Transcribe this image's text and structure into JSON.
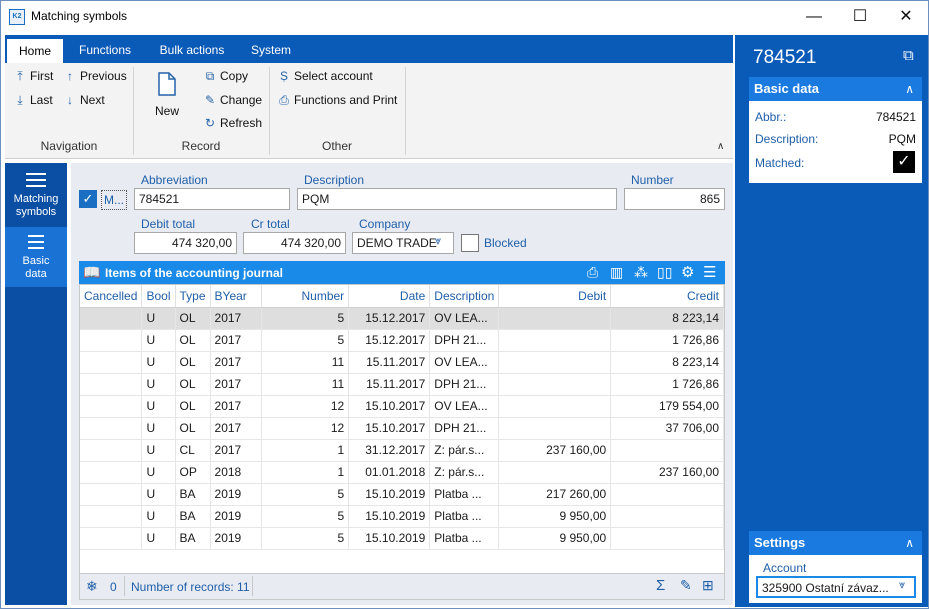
{
  "window": {
    "title": "Matching symbols",
    "app_icon": "k2-logo-icon",
    "minimize": "—",
    "maximize": "☐",
    "close": "✕"
  },
  "tabs": [
    "Home",
    "Functions",
    "Bulk actions",
    "System"
  ],
  "ribbon": {
    "navigation": {
      "label": "Navigation",
      "first": "First",
      "previous": "Previous",
      "last": "Last",
      "next": "Next"
    },
    "record": {
      "label": "Record",
      "new": "New",
      "copy": "Copy",
      "change": "Change",
      "refresh": "Refresh"
    },
    "other": {
      "label": "Other",
      "select_account": "Select account",
      "functions_print": "Functions and Print"
    }
  },
  "leftnav": [
    {
      "label1": "Matching",
      "label2": "symbols",
      "icon": "menu-icon"
    },
    {
      "label1": "Basic",
      "label2": "data",
      "icon": "list-icon"
    }
  ],
  "form": {
    "m_label": "M...",
    "abbreviation_label": "Abbreviation",
    "abbreviation": "784521",
    "description_label": "Description",
    "description": "PQM",
    "number_label": "Number",
    "number": "865",
    "debit_total_label": "Debit total",
    "debit_total": "474 320,00",
    "cr_total_label": "Cr total",
    "cr_total": "474 320,00",
    "company_label": "Company",
    "company": "DEMO TRADE",
    "blocked_label": "Blocked"
  },
  "grid": {
    "title": "Items of the accounting journal",
    "columns": [
      "Cancelled",
      "Bool",
      "Type",
      "BYear",
      "Number",
      "Date",
      "Description",
      "Debit",
      "Credit"
    ],
    "rows": [
      [
        "",
        "U",
        "OL",
        "2017",
        "5",
        "15.12.2017",
        "OV LEA...",
        "",
        "8 223,14"
      ],
      [
        "",
        "U",
        "OL",
        "2017",
        "5",
        "15.12.2017",
        "DPH 21...",
        "",
        "1 726,86"
      ],
      [
        "",
        "U",
        "OL",
        "2017",
        "11",
        "15.11.2017",
        "OV LEA...",
        "",
        "8 223,14"
      ],
      [
        "",
        "U",
        "OL",
        "2017",
        "11",
        "15.11.2017",
        "DPH 21...",
        "",
        "1 726,86"
      ],
      [
        "",
        "U",
        "OL",
        "2017",
        "12",
        "15.10.2017",
        "OV LEA...",
        "",
        "179 554,00"
      ],
      [
        "",
        "U",
        "OL",
        "2017",
        "12",
        "15.10.2017",
        "DPH 21...",
        "",
        "37 706,00"
      ],
      [
        "",
        "U",
        "CL",
        "2017",
        "1",
        "31.12.2017",
        "Z: pár.s...",
        "237 160,00",
        ""
      ],
      [
        "",
        "U",
        "OP",
        "2018",
        "1",
        "01.01.2018",
        "Z: pár.s...",
        "",
        "237 160,00"
      ],
      [
        "",
        "U",
        "BA",
        "2019",
        "5",
        "15.10.2019",
        "Platba ...",
        "217 260,00",
        ""
      ],
      [
        "",
        "U",
        "BA",
        "2019",
        "5",
        "15.10.2019",
        "Platba ...",
        "9 950,00",
        ""
      ],
      [
        "",
        "U",
        "BA",
        "2019",
        "5",
        "15.10.2019",
        "Platba ...",
        "9 950,00",
        ""
      ]
    ],
    "footer_count": "0",
    "footer_records": "Number of records: 11"
  },
  "right": {
    "title": "784521",
    "basic_data": "Basic data",
    "abbr_label": "Abbr.:",
    "abbr": "784521",
    "desc_label": "Description:",
    "desc": "PQM",
    "matched_label": "Matched:",
    "settings": "Settings",
    "account_label": "Account",
    "account": "325900 Ostatní závaz..."
  }
}
